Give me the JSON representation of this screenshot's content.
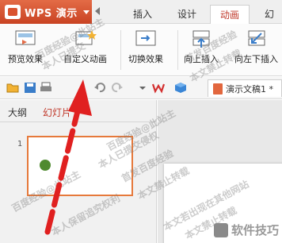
{
  "app": {
    "name": "WPS 演示"
  },
  "tabs": [
    {
      "label": "插入",
      "active": false
    },
    {
      "label": "设计",
      "active": false
    },
    {
      "label": "动画",
      "active": true
    },
    {
      "label": "幻",
      "active": false
    }
  ],
  "ribbon": {
    "preview_label": "预览效果",
    "custom_anim_label": "自定义动画",
    "switch_effect_label": "切换效果",
    "insert_up_label": "向上插入",
    "insert_left_down_label": "向左下插入"
  },
  "document": {
    "tab_title": "演示文稿1 *"
  },
  "left_pane": {
    "tabs": [
      {
        "label": "大纲"
      },
      {
        "label": "幻灯片"
      }
    ],
    "slide_number": "1"
  },
  "watermarks": [
    "百度经验@此站主",
    "本人已提交",
    "首发百度经验",
    "本文禁止转载",
    "百度经验@此站主",
    "本人已提交侵权",
    "首发百度经验",
    "本文禁止转载",
    "本人保留追究权利",
    "百度经验@此站主",
    "本文若出现在其他网站",
    "本文禁止转载"
  ],
  "brand": "软件技巧",
  "colors": {
    "accent": "#c0392b",
    "app_bar": "#d9532f",
    "thumb_border": "#e6793b",
    "dot": "#4f8a2f",
    "arrow": "#e02020"
  }
}
